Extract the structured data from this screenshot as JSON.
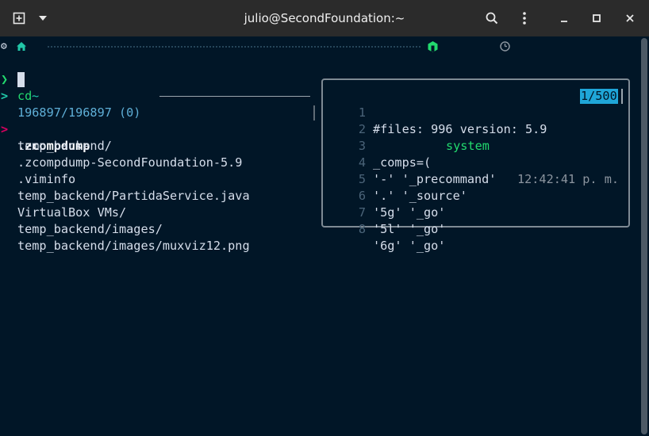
{
  "window": {
    "title": "julio@SecondFoundation:~",
    "buttons": {
      "new_tab_icon": "new-tab-icon",
      "menu_icon": "chevron-down-icon",
      "search_icon": "search-icon",
      "kebab_icon": "kebab-menu-icon",
      "minimize_icon": "minimize-icon",
      "maximize_icon": "maximize-icon",
      "close_icon": "close-icon"
    }
  },
  "prompt": {
    "dir": "~",
    "env_name": "system",
    "time": "12:42:41 p. m.",
    "command": "cd",
    "cursor_prompt": ">"
  },
  "fzf": {
    "counter": "196897/196897 (0)",
    "pointer": ">",
    "results": [
      ".zcompdump",
      "temp_backend/",
      ".zcompdump-SecondFoundation-5.9",
      ".viminfo",
      "temp_backend/PartidaService.java",
      "VirtualBox VMs/",
      "temp_backend/images/",
      "temp_backend/images/muxviz12.png"
    ]
  },
  "preview": {
    "position": "1/500",
    "lines": [
      {
        "num": "1",
        "text": "#files: 996 version: 5.9"
      },
      {
        "num": "2",
        "text": ""
      },
      {
        "num": "3",
        "text": "_comps=("
      },
      {
        "num": "4",
        "text": "'-' '_precommand'"
      },
      {
        "num": "5",
        "text": "'.' '_source'"
      },
      {
        "num": "6",
        "text": "'5g' '_go'"
      },
      {
        "num": "7",
        "text": "'5l' '_go'"
      },
      {
        "num": "8",
        "text": "'6g' '_go'"
      }
    ]
  },
  "colors": {
    "background": "#011627",
    "prompt_green": "#22da6e",
    "accent_cyan": "#21c7a8",
    "info_blue": "#5fafd7",
    "pointer_red": "#d7005f",
    "time_gray": "#8b949e",
    "preview_border": "#7f8a94",
    "position_bg": "#1fa6d8"
  }
}
